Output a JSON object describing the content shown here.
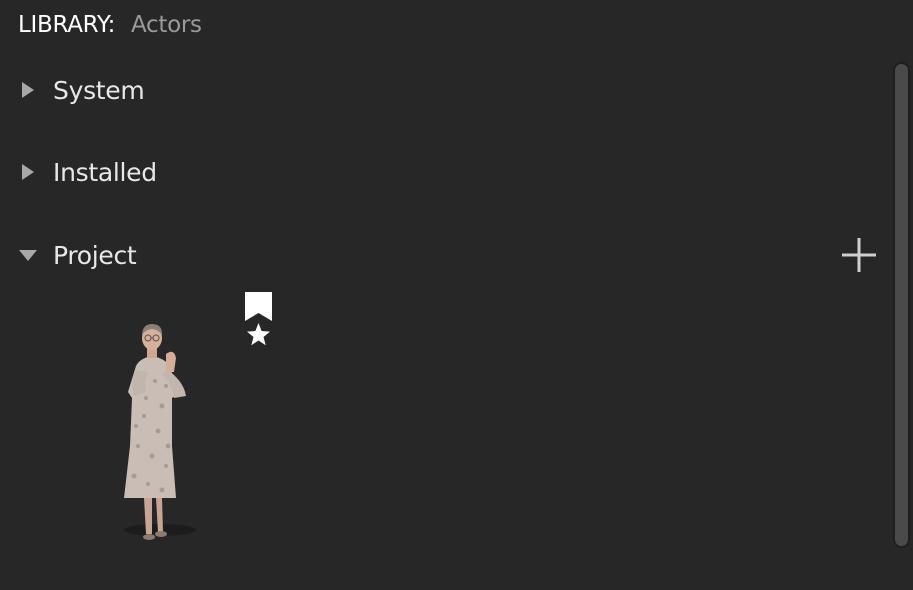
{
  "header": {
    "label": "LIBRARY:",
    "value": "Actors"
  },
  "sections": [
    {
      "label": "System",
      "expanded": false
    },
    {
      "label": "Installed",
      "expanded": false
    },
    {
      "label": "Project",
      "expanded": true
    }
  ],
  "project": {
    "add_icon": "plus-icon",
    "assets": [
      {
        "thumbnail": "elderly-woman-actor",
        "badges": [
          "bookmark-icon",
          "star-icon"
        ]
      }
    ]
  },
  "colors": {
    "background": "#272727",
    "text": "#e8e8e8",
    "subtext": "#9a9a9a",
    "icon": "#cfcfcf",
    "scrollbar": "#4a4a4a"
  }
}
